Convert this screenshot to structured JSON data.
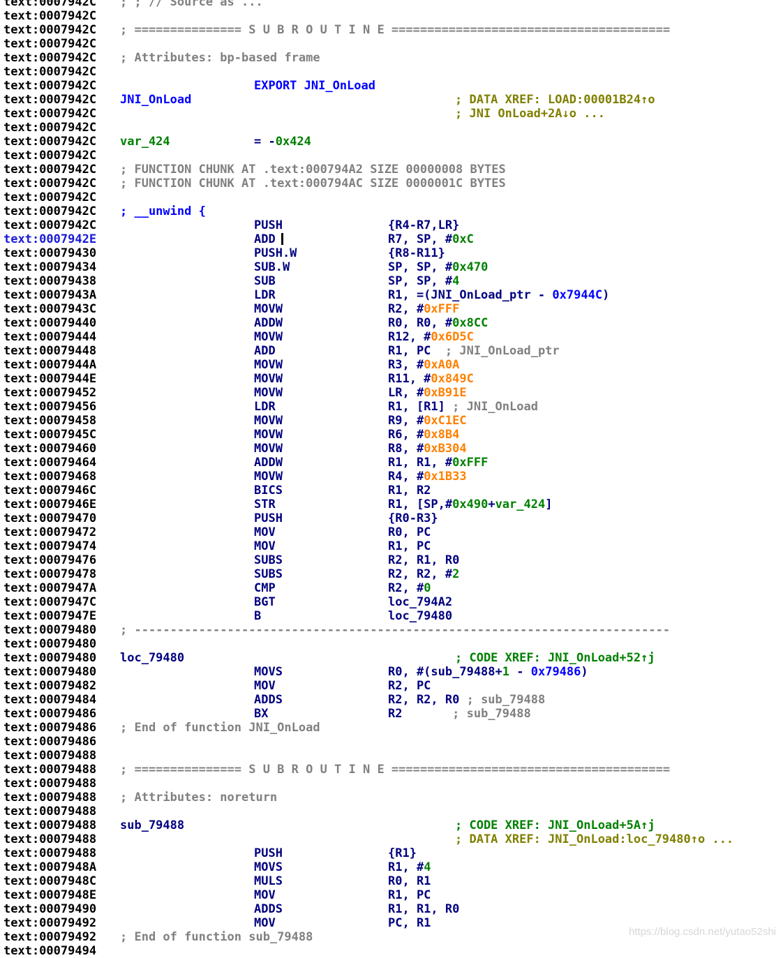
{
  "colors": {
    "address": "#000000",
    "address_current": "#1a1ad6",
    "instruction": "#000080",
    "comment": "#808080",
    "xref": "#808000",
    "code_xref": "#008000",
    "number": "#008000",
    "const": "#ff8000",
    "name": "#0000ff",
    "var": "#008000"
  },
  "lines": [
    {
      "addr": "text:0007942C",
      "parts": [
        {
          "col": 1,
          "text": "; ; // Source as ...",
          "color": "#808080"
        }
      ]
    },
    {
      "addr": "text:0007942C"
    },
    {
      "addr": "text:0007942C",
      "parts": [
        {
          "col": 1,
          "text": "; =============== S U B R O U T I N E =======================================",
          "color": "#808080"
        }
      ]
    },
    {
      "addr": "text:0007942C"
    },
    {
      "addr": "text:0007942C",
      "parts": [
        {
          "col": 1,
          "text": "; Attributes: bp-based frame",
          "color": "#808080"
        }
      ]
    },
    {
      "addr": "text:0007942C"
    },
    {
      "addr": "text:0007942C",
      "parts": [
        {
          "col": 2,
          "text": "EXPORT JNI_OnLoad",
          "color": "#0000ff"
        }
      ]
    },
    {
      "addr": "text:0007942C",
      "parts": [
        {
          "col": 1,
          "text": "JNI_OnLoad",
          "color": "#0000ff"
        },
        {
          "col": 4,
          "text": "; DATA XREF: LOAD:00001B24↑o",
          "color": "#808000"
        }
      ]
    },
    {
      "addr": "text:0007942C",
      "parts": [
        {
          "col": 4,
          "text": "; JNI OnLoad+2A↓o ...",
          "color": "#808000"
        }
      ]
    },
    {
      "addr": "text:0007942C"
    },
    {
      "addr": "text:0007942C",
      "parts": [
        {
          "col": 1,
          "text": "var_424",
          "color": "#008000"
        },
        {
          "col": 2,
          "segs": [
            {
              "t": "= -",
              "c": "#000080"
            },
            {
              "t": "0x424",
              "c": "#008000"
            }
          ]
        }
      ]
    },
    {
      "addr": "text:0007942C"
    },
    {
      "addr": "text:0007942C",
      "parts": [
        {
          "col": 1,
          "text": "; FUNCTION CHUNK AT .text:000794A2 SIZE 00000008 BYTES",
          "color": "#808080"
        }
      ]
    },
    {
      "addr": "text:0007942C",
      "parts": [
        {
          "col": 1,
          "text": "; FUNCTION CHUNK AT .text:000794AC SIZE 0000001C BYTES",
          "color": "#808080"
        }
      ]
    },
    {
      "addr": "text:0007942C"
    },
    {
      "addr": "text:0007942C",
      "parts": [
        {
          "col": 1,
          "text": "; __unwind {",
          "color": "#0000ff"
        }
      ]
    },
    {
      "addr": "text:0007942C",
      "parts": [
        {
          "col": 2,
          "text": "PUSH",
          "color": "#000080"
        },
        {
          "col": 3,
          "text": "{R4-R7,LR}",
          "color": "#000080"
        }
      ]
    },
    {
      "addr": "text:0007942E",
      "current": true,
      "parts": [
        {
          "col": 2,
          "text": "ADD",
          "color": "#000080",
          "cursor": true
        },
        {
          "col": 3,
          "segs": [
            {
              "t": "R7, SP, #",
              "c": "#000080"
            },
            {
              "t": "0xC",
              "c": "#008000"
            }
          ]
        }
      ]
    },
    {
      "addr": "text:00079430",
      "parts": [
        {
          "col": 2,
          "text": "PUSH.W",
          "color": "#000080"
        },
        {
          "col": 3,
          "text": "{R8-R11}",
          "color": "#000080"
        }
      ]
    },
    {
      "addr": "text:00079434",
      "parts": [
        {
          "col": 2,
          "text": "SUB.W",
          "color": "#000080"
        },
        {
          "col": 3,
          "segs": [
            {
              "t": "SP, SP, #",
              "c": "#000080"
            },
            {
              "t": "0x470",
              "c": "#008000"
            }
          ]
        }
      ]
    },
    {
      "addr": "text:00079438",
      "parts": [
        {
          "col": 2,
          "text": "SUB",
          "color": "#000080"
        },
        {
          "col": 3,
          "segs": [
            {
              "t": "SP, SP, #",
              "c": "#000080"
            },
            {
              "t": "4",
              "c": "#008000"
            }
          ]
        }
      ]
    },
    {
      "addr": "text:0007943A",
      "parts": [
        {
          "col": 2,
          "text": "LDR",
          "color": "#000080"
        },
        {
          "col": 3,
          "segs": [
            {
              "t": "R1, =(JNI_OnLoad_ptr - ",
              "c": "#000080"
            },
            {
              "t": "0x7944C",
              "c": "#0000ff"
            },
            {
              "t": ")",
              "c": "#000080"
            }
          ]
        }
      ]
    },
    {
      "addr": "text:0007943C",
      "parts": [
        {
          "col": 2,
          "text": "MOVW",
          "color": "#000080"
        },
        {
          "col": 3,
          "segs": [
            {
              "t": "R2, #",
              "c": "#000080"
            },
            {
              "t": "0xFFF",
              "c": "#ff8000"
            }
          ]
        }
      ]
    },
    {
      "addr": "text:00079440",
      "parts": [
        {
          "col": 2,
          "text": "ADDW",
          "color": "#000080"
        },
        {
          "col": 3,
          "segs": [
            {
              "t": "R0, R0, #",
              "c": "#000080"
            },
            {
              "t": "0x8CC",
              "c": "#008000"
            }
          ]
        }
      ]
    },
    {
      "addr": "text:00079444",
      "parts": [
        {
          "col": 2,
          "text": "MOVW",
          "color": "#000080"
        },
        {
          "col": 3,
          "segs": [
            {
              "t": "R12, #",
              "c": "#000080"
            },
            {
              "t": "0x6D5C",
              "c": "#ff8000"
            }
          ]
        }
      ]
    },
    {
      "addr": "text:00079448",
      "parts": [
        {
          "col": 2,
          "text": "ADD",
          "color": "#000080"
        },
        {
          "col": 3,
          "segs": [
            {
              "t": "R1, PC",
              "c": "#000080"
            },
            {
              "t": "  ; JNI_OnLoad_ptr",
              "c": "#808080"
            }
          ]
        }
      ]
    },
    {
      "addr": "text:0007944A",
      "parts": [
        {
          "col": 2,
          "text": "MOVW",
          "color": "#000080"
        },
        {
          "col": 3,
          "segs": [
            {
              "t": "R3, #",
              "c": "#000080"
            },
            {
              "t": "0xA0A",
              "c": "#ff8000"
            }
          ]
        }
      ]
    },
    {
      "addr": "text:0007944E",
      "parts": [
        {
          "col": 2,
          "text": "MOVW",
          "color": "#000080"
        },
        {
          "col": 3,
          "segs": [
            {
              "t": "R11, #",
              "c": "#000080"
            },
            {
              "t": "0x849C",
              "c": "#ff8000"
            }
          ]
        }
      ]
    },
    {
      "addr": "text:00079452",
      "parts": [
        {
          "col": 2,
          "text": "MOVW",
          "color": "#000080"
        },
        {
          "col": 3,
          "segs": [
            {
              "t": "LR, #",
              "c": "#000080"
            },
            {
              "t": "0xB91E",
              "c": "#ff8000"
            }
          ]
        }
      ]
    },
    {
      "addr": "text:00079456",
      "parts": [
        {
          "col": 2,
          "text": "LDR",
          "color": "#000080"
        },
        {
          "col": 3,
          "segs": [
            {
              "t": "R1, [R1]",
              "c": "#000080"
            },
            {
              "t": " ; JNI_OnLoad",
              "c": "#808080"
            }
          ]
        }
      ]
    },
    {
      "addr": "text:00079458",
      "parts": [
        {
          "col": 2,
          "text": "MOVW",
          "color": "#000080"
        },
        {
          "col": 3,
          "segs": [
            {
              "t": "R9, #",
              "c": "#000080"
            },
            {
              "t": "0xC1EC",
              "c": "#ff8000"
            }
          ]
        }
      ]
    },
    {
      "addr": "text:0007945C",
      "parts": [
        {
          "col": 2,
          "text": "MOVW",
          "color": "#000080"
        },
        {
          "col": 3,
          "segs": [
            {
              "t": "R6, #",
              "c": "#000080"
            },
            {
              "t": "0x8B4",
              "c": "#ff8000"
            }
          ]
        }
      ]
    },
    {
      "addr": "text:00079460",
      "parts": [
        {
          "col": 2,
          "text": "MOVW",
          "color": "#000080"
        },
        {
          "col": 3,
          "segs": [
            {
              "t": "R8, #",
              "c": "#000080"
            },
            {
              "t": "0xB304",
              "c": "#ff8000"
            }
          ]
        }
      ]
    },
    {
      "addr": "text:00079464",
      "parts": [
        {
          "col": 2,
          "text": "ADDW",
          "color": "#000080"
        },
        {
          "col": 3,
          "segs": [
            {
              "t": "R1, R1, #",
              "c": "#000080"
            },
            {
              "t": "0xFFF",
              "c": "#008000"
            }
          ]
        }
      ]
    },
    {
      "addr": "text:00079468",
      "parts": [
        {
          "col": 2,
          "text": "MOVW",
          "color": "#000080"
        },
        {
          "col": 3,
          "segs": [
            {
              "t": "R4, #",
              "c": "#000080"
            },
            {
              "t": "0x1B33",
              "c": "#ff8000"
            }
          ]
        }
      ]
    },
    {
      "addr": "text:0007946C",
      "parts": [
        {
          "col": 2,
          "text": "BICS",
          "color": "#000080"
        },
        {
          "col": 3,
          "text": "R1, R2",
          "color": "#000080"
        }
      ]
    },
    {
      "addr": "text:0007946E",
      "parts": [
        {
          "col": 2,
          "text": "STR",
          "color": "#000080"
        },
        {
          "col": 3,
          "segs": [
            {
              "t": "R1, [SP,#",
              "c": "#000080"
            },
            {
              "t": "0x490",
              "c": "#008000"
            },
            {
              "t": "+",
              "c": "#000080"
            },
            {
              "t": "var_424",
              "c": "#008000"
            },
            {
              "t": "]",
              "c": "#000080"
            }
          ]
        }
      ]
    },
    {
      "addr": "text:00079470",
      "parts": [
        {
          "col": 2,
          "text": "PUSH",
          "color": "#000080"
        },
        {
          "col": 3,
          "text": "{R0-R3}",
          "color": "#000080"
        }
      ]
    },
    {
      "addr": "text:00079472",
      "parts": [
        {
          "col": 2,
          "text": "MOV",
          "color": "#000080"
        },
        {
          "col": 3,
          "text": "R0, PC",
          "color": "#000080"
        }
      ]
    },
    {
      "addr": "text:00079474",
      "parts": [
        {
          "col": 2,
          "text": "MOV",
          "color": "#000080"
        },
        {
          "col": 3,
          "text": "R1, PC",
          "color": "#000080"
        }
      ]
    },
    {
      "addr": "text:00079476",
      "parts": [
        {
          "col": 2,
          "text": "SUBS",
          "color": "#000080"
        },
        {
          "col": 3,
          "text": "R2, R1, R0",
          "color": "#000080"
        }
      ]
    },
    {
      "addr": "text:00079478",
      "parts": [
        {
          "col": 2,
          "text": "SUBS",
          "color": "#000080"
        },
        {
          "col": 3,
          "segs": [
            {
              "t": "R2, R2, #",
              "c": "#000080"
            },
            {
              "t": "2",
              "c": "#008000"
            }
          ]
        }
      ]
    },
    {
      "addr": "text:0007947A",
      "parts": [
        {
          "col": 2,
          "text": "CMP",
          "color": "#000080"
        },
        {
          "col": 3,
          "segs": [
            {
              "t": "R2, #",
              "c": "#000080"
            },
            {
              "t": "0",
              "c": "#008000"
            }
          ]
        }
      ]
    },
    {
      "addr": "text:0007947C",
      "parts": [
        {
          "col": 2,
          "text": "BGT",
          "color": "#000080"
        },
        {
          "col": 3,
          "text": "loc_794A2",
          "color": "#000080"
        }
      ]
    },
    {
      "addr": "text:0007947E",
      "parts": [
        {
          "col": 2,
          "text": "B",
          "color": "#000080"
        },
        {
          "col": 3,
          "text": "loc_79480",
          "color": "#000080"
        }
      ]
    },
    {
      "addr": "text:00079480",
      "parts": [
        {
          "col": 1,
          "text": "; ---------------------------------------------------------------------------",
          "color": "#808080"
        }
      ]
    },
    {
      "addr": "text:00079480"
    },
    {
      "addr": "text:00079480",
      "parts": [
        {
          "col": 1,
          "text": "loc_79480",
          "color": "#000080"
        },
        {
          "col": 4,
          "text": "; CODE XREF: JNI_OnLoad+52↑j",
          "color": "#008000"
        }
      ]
    },
    {
      "addr": "text:00079480",
      "parts": [
        {
          "col": 2,
          "text": "MOVS",
          "color": "#000080"
        },
        {
          "col": 3,
          "segs": [
            {
              "t": "R0, #(sub_79488+",
              "c": "#000080"
            },
            {
              "t": "1",
              "c": "#008000"
            },
            {
              "t": " - ",
              "c": "#000080"
            },
            {
              "t": "0x79486",
              "c": "#0000ff"
            },
            {
              "t": ")",
              "c": "#000080"
            }
          ]
        }
      ]
    },
    {
      "addr": "text:00079482",
      "parts": [
        {
          "col": 2,
          "text": "MOV",
          "color": "#000080"
        },
        {
          "col": 3,
          "text": "R2, PC",
          "color": "#000080"
        }
      ]
    },
    {
      "addr": "text:00079484",
      "parts": [
        {
          "col": 2,
          "text": "ADDS",
          "color": "#000080"
        },
        {
          "col": 3,
          "segs": [
            {
              "t": "R2, R2, R0",
              "c": "#000080"
            },
            {
              "t": " ; sub_79488",
              "c": "#808080"
            }
          ]
        }
      ]
    },
    {
      "addr": "text:00079486",
      "parts": [
        {
          "col": 2,
          "text": "BX",
          "color": "#000080"
        },
        {
          "col": 3,
          "segs": [
            {
              "t": "R2",
              "c": "#000080"
            },
            {
              "t": "       ; sub_79488",
              "c": "#808080"
            }
          ]
        }
      ]
    },
    {
      "addr": "text:00079486",
      "parts": [
        {
          "col": 1,
          "text": "; End of function JNI_OnLoad",
          "color": "#808080"
        }
      ]
    },
    {
      "addr": "text:00079486"
    },
    {
      "addr": "text:00079488"
    },
    {
      "addr": "text:00079488",
      "parts": [
        {
          "col": 1,
          "text": "; =============== S U B R O U T I N E =======================================",
          "color": "#808080"
        }
      ]
    },
    {
      "addr": "text:00079488"
    },
    {
      "addr": "text:00079488",
      "parts": [
        {
          "col": 1,
          "text": "; Attributes: noreturn",
          "color": "#808080"
        }
      ]
    },
    {
      "addr": "text:00079488"
    },
    {
      "addr": "text:00079488",
      "parts": [
        {
          "col": 1,
          "text": "sub_79488",
          "color": "#000080"
        },
        {
          "col": 4,
          "text": "; CODE XREF: JNI_OnLoad+5A↑j",
          "color": "#008000"
        }
      ]
    },
    {
      "addr": "text:00079488",
      "parts": [
        {
          "col": 4,
          "text": "; DATA XREF: JNI_OnLoad:loc_79480↑o ...",
          "color": "#808000"
        }
      ]
    },
    {
      "addr": "text:00079488",
      "parts": [
        {
          "col": 2,
          "text": "PUSH",
          "color": "#000080"
        },
        {
          "col": 3,
          "text": "{R1}",
          "color": "#000080"
        }
      ]
    },
    {
      "addr": "text:0007948A",
      "parts": [
        {
          "col": 2,
          "text": "MOVS",
          "color": "#000080"
        },
        {
          "col": 3,
          "segs": [
            {
              "t": "R1, #",
              "c": "#000080"
            },
            {
              "t": "4",
              "c": "#008000"
            }
          ]
        }
      ]
    },
    {
      "addr": "text:0007948C",
      "parts": [
        {
          "col": 2,
          "text": "MULS",
          "color": "#000080"
        },
        {
          "col": 3,
          "text": "R0, R1",
          "color": "#000080"
        }
      ]
    },
    {
      "addr": "text:0007948E",
      "parts": [
        {
          "col": 2,
          "text": "MOV",
          "color": "#000080"
        },
        {
          "col": 3,
          "text": "R1, PC",
          "color": "#000080"
        }
      ]
    },
    {
      "addr": "text:00079490",
      "parts": [
        {
          "col": 2,
          "text": "ADDS",
          "color": "#000080"
        },
        {
          "col": 3,
          "text": "R1, R1, R0",
          "color": "#000080"
        }
      ]
    },
    {
      "addr": "text:00079492",
      "parts": [
        {
          "col": 2,
          "text": "MOV",
          "color": "#000080"
        },
        {
          "col": 3,
          "text": "PC, R1",
          "color": "#000080"
        }
      ]
    },
    {
      "addr": "text:00079492",
      "parts": [
        {
          "col": 1,
          "text": "; End of function sub_79488",
          "color": "#808080"
        }
      ]
    },
    {
      "addr": "text:00079494"
    }
  ],
  "watermark": "https://blog.csdn.net/yutao52shi"
}
